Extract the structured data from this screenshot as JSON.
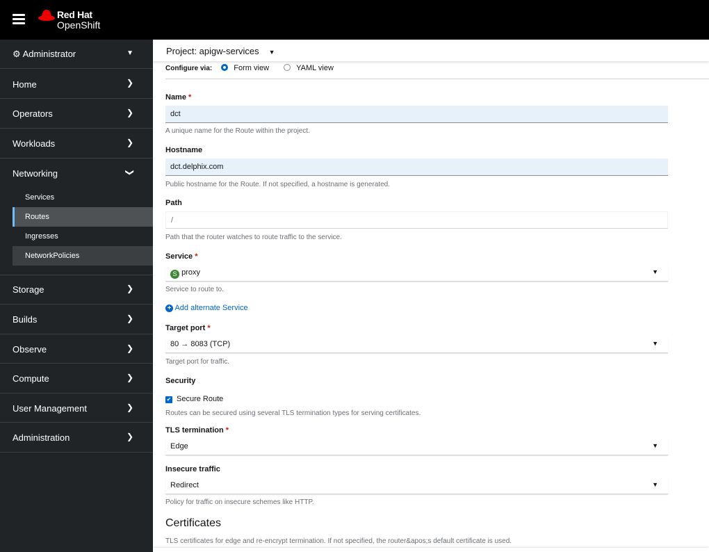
{
  "header": {
    "brand_line1": "Red Hat",
    "brand_line2": "OpenShift"
  },
  "sidebar": {
    "perspective": "Administrator",
    "items": [
      {
        "label": "Home"
      },
      {
        "label": "Operators"
      },
      {
        "label": "Workloads"
      },
      {
        "label": "Networking"
      },
      {
        "label": "Storage"
      },
      {
        "label": "Builds"
      },
      {
        "label": "Observe"
      },
      {
        "label": "Compute"
      },
      {
        "label": "User Management"
      },
      {
        "label": "Administration"
      }
    ],
    "networking_sub": [
      "Services",
      "Routes",
      "Ingresses",
      "NetworkPolicies"
    ],
    "selected": "Routes"
  },
  "project": {
    "label": "Project: apigw-services"
  },
  "configure": {
    "label": "Configure via:",
    "form": "Form view",
    "yaml": "YAML view",
    "selected": "Form view"
  },
  "form": {
    "name": {
      "label": "Name",
      "value": "dct",
      "help": "A unique name for the Route within the project."
    },
    "hostname": {
      "label": "Hostname",
      "value": "dct.delphix.com",
      "help": "Public hostname for the Route. If not specified, a hostname is generated."
    },
    "path": {
      "label": "Path",
      "value": "/",
      "help": "Path that the router watches to route traffic to the service."
    },
    "service": {
      "label": "Service",
      "badge": "S",
      "value": "proxy",
      "help": "Service to route to."
    },
    "add_alt": "Add alternate Service",
    "target_port": {
      "label": "Target port",
      "value": "80 → 8083 (TCP)",
      "help": "Target port for traffic."
    },
    "security": {
      "label": "Security",
      "secure_route": "Secure Route",
      "checked": true,
      "help": "Routes can be secured using several TLS termination types for serving certificates."
    },
    "tls": {
      "label": "TLS termination",
      "value": "Edge"
    },
    "insecure": {
      "label": "Insecure traffic",
      "value": "Redirect",
      "help": "Policy for traffic on insecure schemes like HTTP."
    },
    "certificates": {
      "title": "Certificates",
      "help": "TLS certificates for edge and re-encrypt termination. If not specified, the router&apos;s default certificate is used."
    },
    "required_mark": "*"
  }
}
